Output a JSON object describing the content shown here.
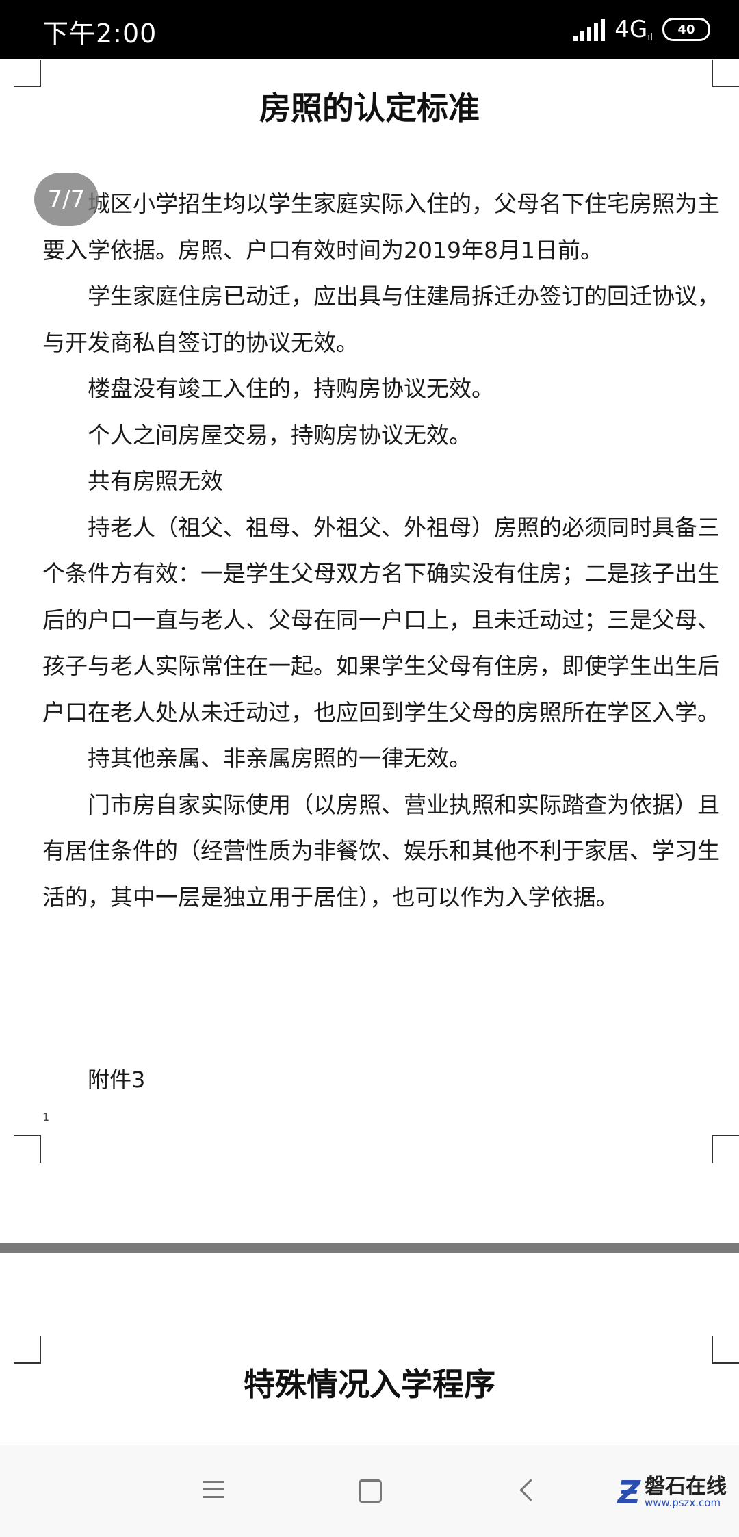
{
  "status_bar": {
    "time": "下午2:00",
    "network": "4G",
    "network_sub": "ıl",
    "battery": "40",
    "icons": [
      "signal-icon",
      "battery-icon"
    ]
  },
  "page_indicator": "7/7",
  "document": {
    "title": "房照的认定标准",
    "paragraphs": [
      "城区小学招生均以学生家庭实际入住的，父母名下住宅房照为主要入学依据。房照、户口有效时间为2019年8月1日前。",
      "学生家庭住房已动迁，应出具与住建局拆迁办签订的回迁协议，与开发商私自签订的协议无效。",
      "楼盘没有竣工入住的，持购房协议无效。",
      "个人之间房屋交易，持购房协议无效。",
      "共有房照无效",
      "持老人（祖父、祖母、外祖父、外祖母）房照的必须同时具备三个条件方有效：一是学生父母双方名下确实没有住房；二是孩子出生后的户口一直与老人、父母在同一户口上，且未迁动过；三是父母、孩子与老人实际常住在一起。如果学生父母有住房，即使学生出生后户口在老人处从未迁动过，也应回到学生父母的房照所在学区入学。",
      "持其他亲属、非亲属房照的一律无效。",
      "门市房自家实际使用（以房照、营业执照和实际踏查为依据）且有居住条件的（经营性质为非餐饮、娱乐和其他不利于家居、学习生活的，其中一层是独立用于居住），也可以作为入学依据。"
    ],
    "attachment": "附件3",
    "page_number": "1",
    "next_page_title": "特殊情况入学程序"
  },
  "nav_bar": {
    "icons": [
      "menu-icon",
      "home-icon",
      "back-icon"
    ]
  },
  "watermark": {
    "name": "磐石在线",
    "url": "www.pszx.com"
  }
}
